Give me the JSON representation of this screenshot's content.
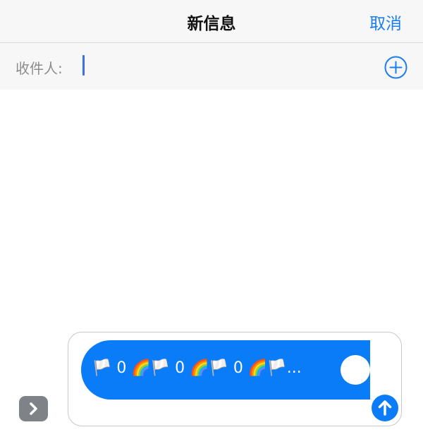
{
  "nav": {
    "title": "新信息",
    "cancel_label": "取消"
  },
  "recipient": {
    "label": "收件人:",
    "value": "",
    "placeholder": ""
  },
  "compose": {
    "preview_text": "🏳️ 0 🌈🏳️ 0 🌈🏳️ 0 🌈🏳️..."
  },
  "icons": {
    "add_contact": "plus-circle-icon",
    "expand": "chevron-right-icon",
    "send": "arrow-up-icon"
  },
  "colors": {
    "accent": "#1a7df0",
    "bubble": "#0a7cf7",
    "caret": "#3f6fd8",
    "expand_button": "#7f8388"
  }
}
